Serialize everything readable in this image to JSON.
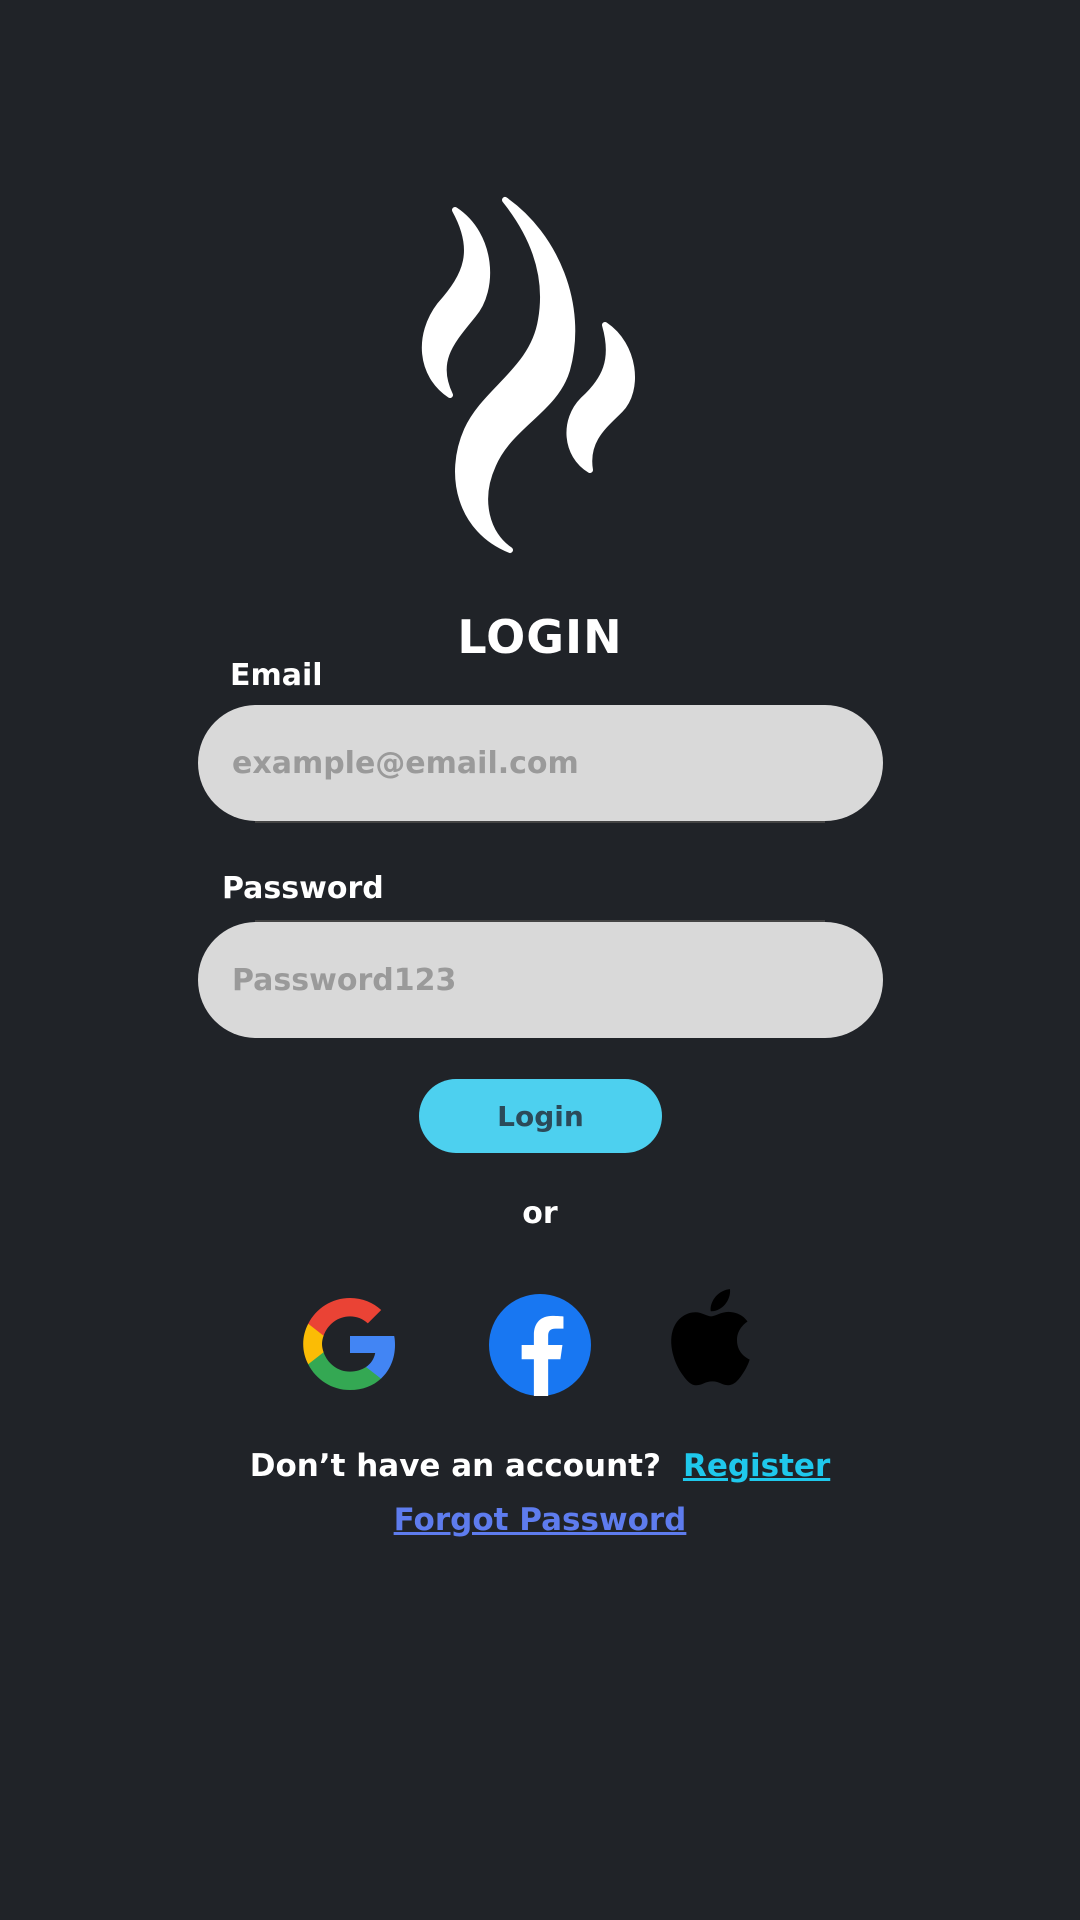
{
  "logo": {
    "icon": "flame-smoke-logo-icon",
    "color": "#ffffff"
  },
  "title": "LOGIN",
  "email": {
    "label": "Email",
    "placeholder": "example@email.com",
    "value": ""
  },
  "password": {
    "label": "Password",
    "placeholder": "Password123",
    "value": ""
  },
  "login_button": {
    "label": "Login",
    "color": "#4dd0ef"
  },
  "or_text": "or",
  "social": [
    {
      "name": "Google",
      "icon": "google-icon"
    },
    {
      "name": "Facebook",
      "icon": "facebook-icon",
      "color": "#1877f2"
    },
    {
      "name": "Apple",
      "icon": "apple-icon",
      "color": "#000000"
    }
  ],
  "account": {
    "prompt": "Don’t have an account?",
    "register_label": "Register",
    "register_color": "#1fc8ec"
  },
  "forgot_password": {
    "label": "Forgot Password",
    "color": "#5e7cee"
  },
  "colors": {
    "background": "#202328",
    "input_background": "#d9d9d9",
    "text": "#ffffff"
  }
}
